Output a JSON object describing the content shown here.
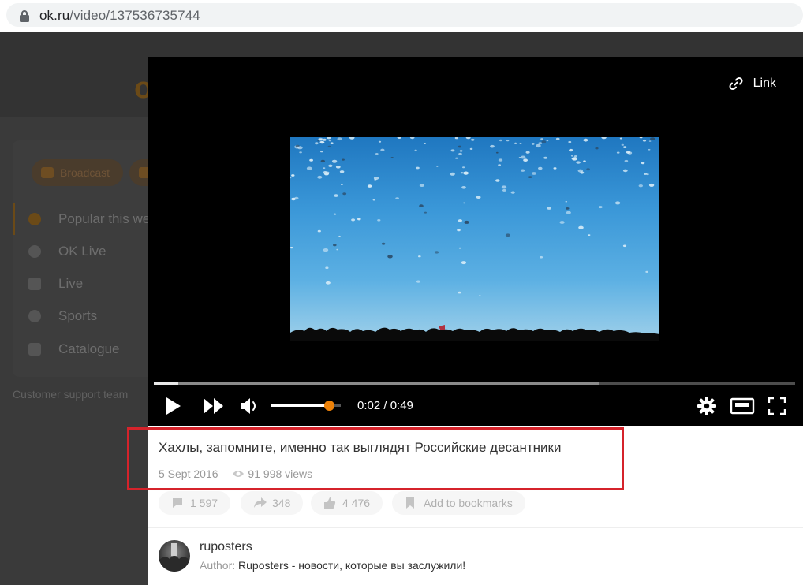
{
  "browser": {
    "url_host": "ok.ru",
    "url_path": "/video/137536735744"
  },
  "sidebar": {
    "pills": [
      "Broadcast",
      ""
    ],
    "items": [
      {
        "label": "Popular this we",
        "icon": "fire-icon",
        "active": true
      },
      {
        "label": "OK Live",
        "icon": "live-circle-icon"
      },
      {
        "label": "Live",
        "icon": "camera-icon"
      },
      {
        "label": "Sports",
        "icon": "sports-icon"
      },
      {
        "label": "Catalogue",
        "icon": "catalogue-icon"
      }
    ],
    "support": "Customer support team"
  },
  "player": {
    "link_label": "Link",
    "time": "0:02 / 0:49",
    "progress_played": 0.038,
    "progress_buffered": 0.695,
    "volume": 0.83,
    "accent": "#ee8208"
  },
  "video": {
    "title": "Хахлы, запомните, именно так выглядят Российские десантники",
    "date": "5 Sept 2016",
    "views": "91 998 views",
    "actions": {
      "comments": "1 597",
      "shares": "348",
      "likes": "4 476",
      "bookmark": "Add to bookmarks"
    }
  },
  "author": {
    "name": "ruposters",
    "label": "Author:",
    "channel": "Ruposters - новости, которые вы заслужили!"
  },
  "highlight_color": "#d5232b"
}
